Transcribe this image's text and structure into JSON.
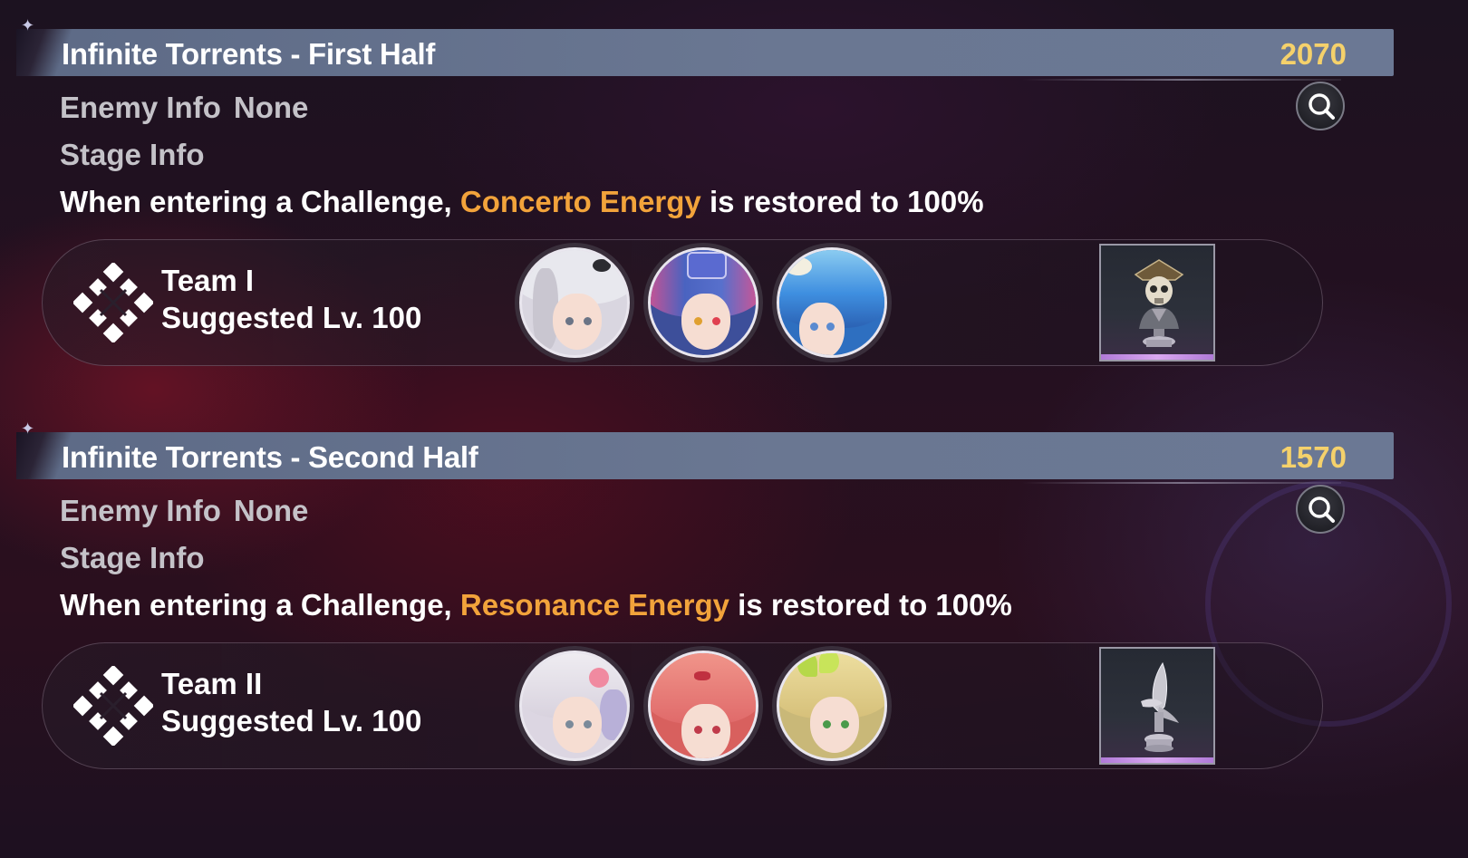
{
  "stages": [
    {
      "title": "Infinite Torrents - First Half",
      "score": "2070",
      "enemy_info_label": "Enemy Info",
      "enemy_info_value": "None",
      "stage_info_label": "Stage Info",
      "description": {
        "prefix": "When entering a Challenge, ",
        "highlight": "Concerto Energy",
        "suffix": " is restored to 100%"
      },
      "team": {
        "name": "Team I",
        "suggested_level": "Suggested Lv. 100",
        "members": [
          "character-silver-hair",
          "character-blue-pink-hair",
          "character-blue-hood"
        ],
        "boss_icon": "skull-pirate-bust-icon"
      }
    },
    {
      "title": "Infinite Torrents - Second Half",
      "score": "1570",
      "enemy_info_label": "Enemy Info",
      "enemy_info_value": "None",
      "stage_info_label": "Stage Info",
      "description": {
        "prefix": "When entering a Challenge, ",
        "highlight": "Resonance Energy",
        "suffix": " is restored to 100%"
      },
      "team": {
        "name": "Team II",
        "suggested_level": "Suggested Lv. 100",
        "members": [
          "character-white-hair-flower",
          "character-pink-hair",
          "character-blonde-leaf"
        ],
        "boss_icon": "silver-blade-statue-icon"
      }
    }
  ],
  "colors": {
    "header_bar": "#65728e",
    "score": "#f5d16b",
    "highlight": "#f2a33b",
    "info_text": "#c4c2c8",
    "boss_card_accent": "#c891e6"
  }
}
